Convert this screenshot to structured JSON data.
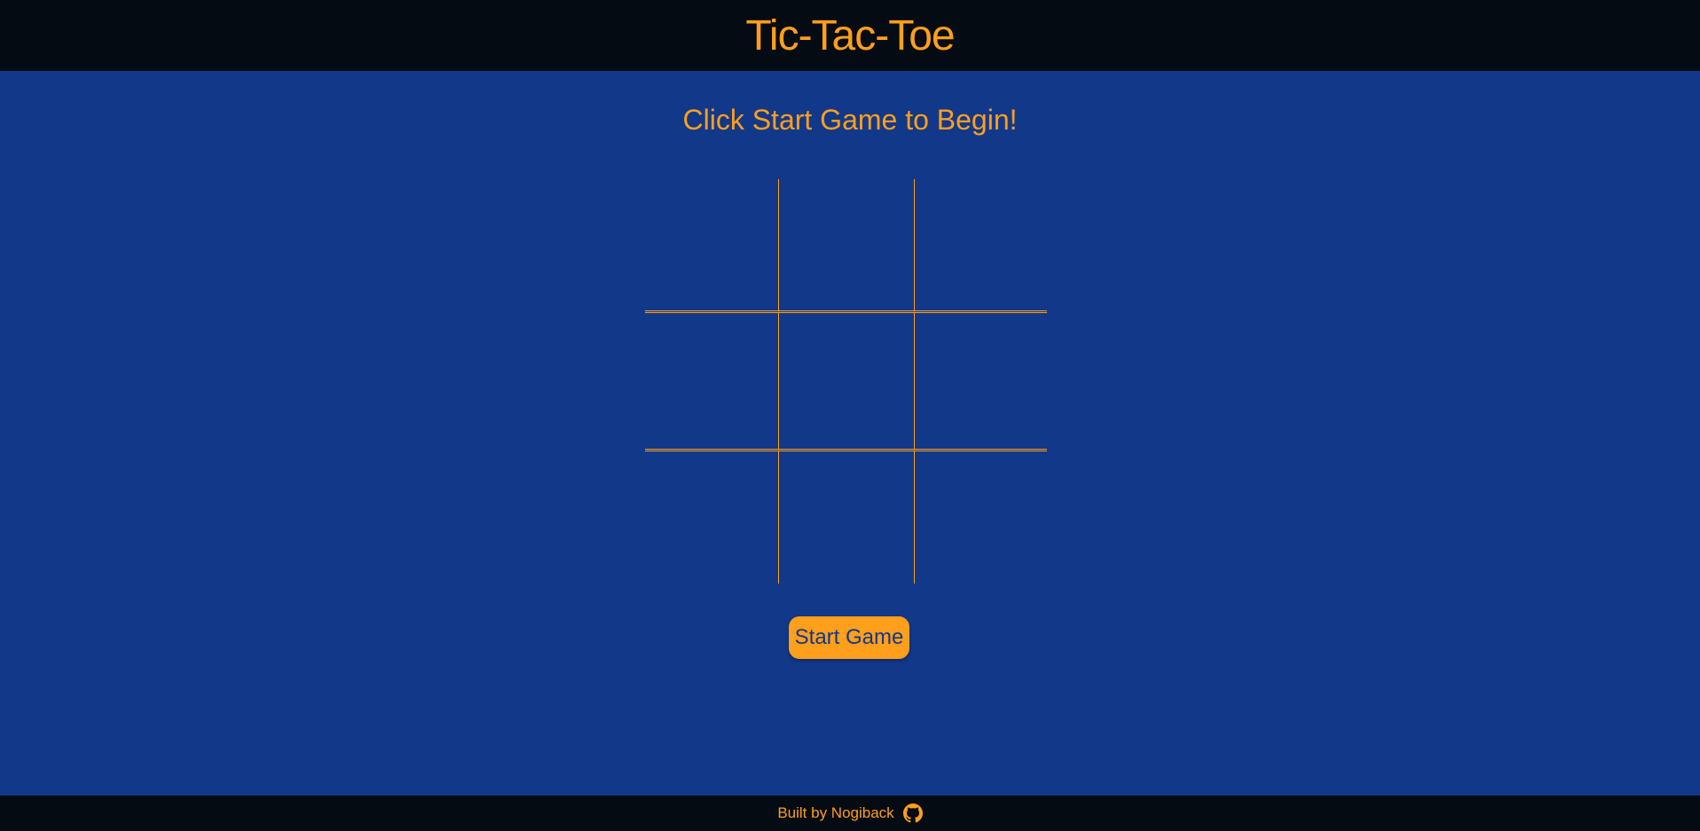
{
  "header": {
    "title": "Tic-Tac-Toe"
  },
  "status": {
    "message": "Click Start Game to Begin!"
  },
  "board": {
    "cells": [
      "",
      "",
      "",
      "",
      "",
      "",
      "",
      "",
      ""
    ]
  },
  "controls": {
    "start_label": "Start Game"
  },
  "footer": {
    "credit": "Built by Nogiback",
    "icon": "github-icon"
  },
  "colors": {
    "background": "#12388a",
    "bar": "#050b13",
    "accent": "#ff9f1c"
  }
}
